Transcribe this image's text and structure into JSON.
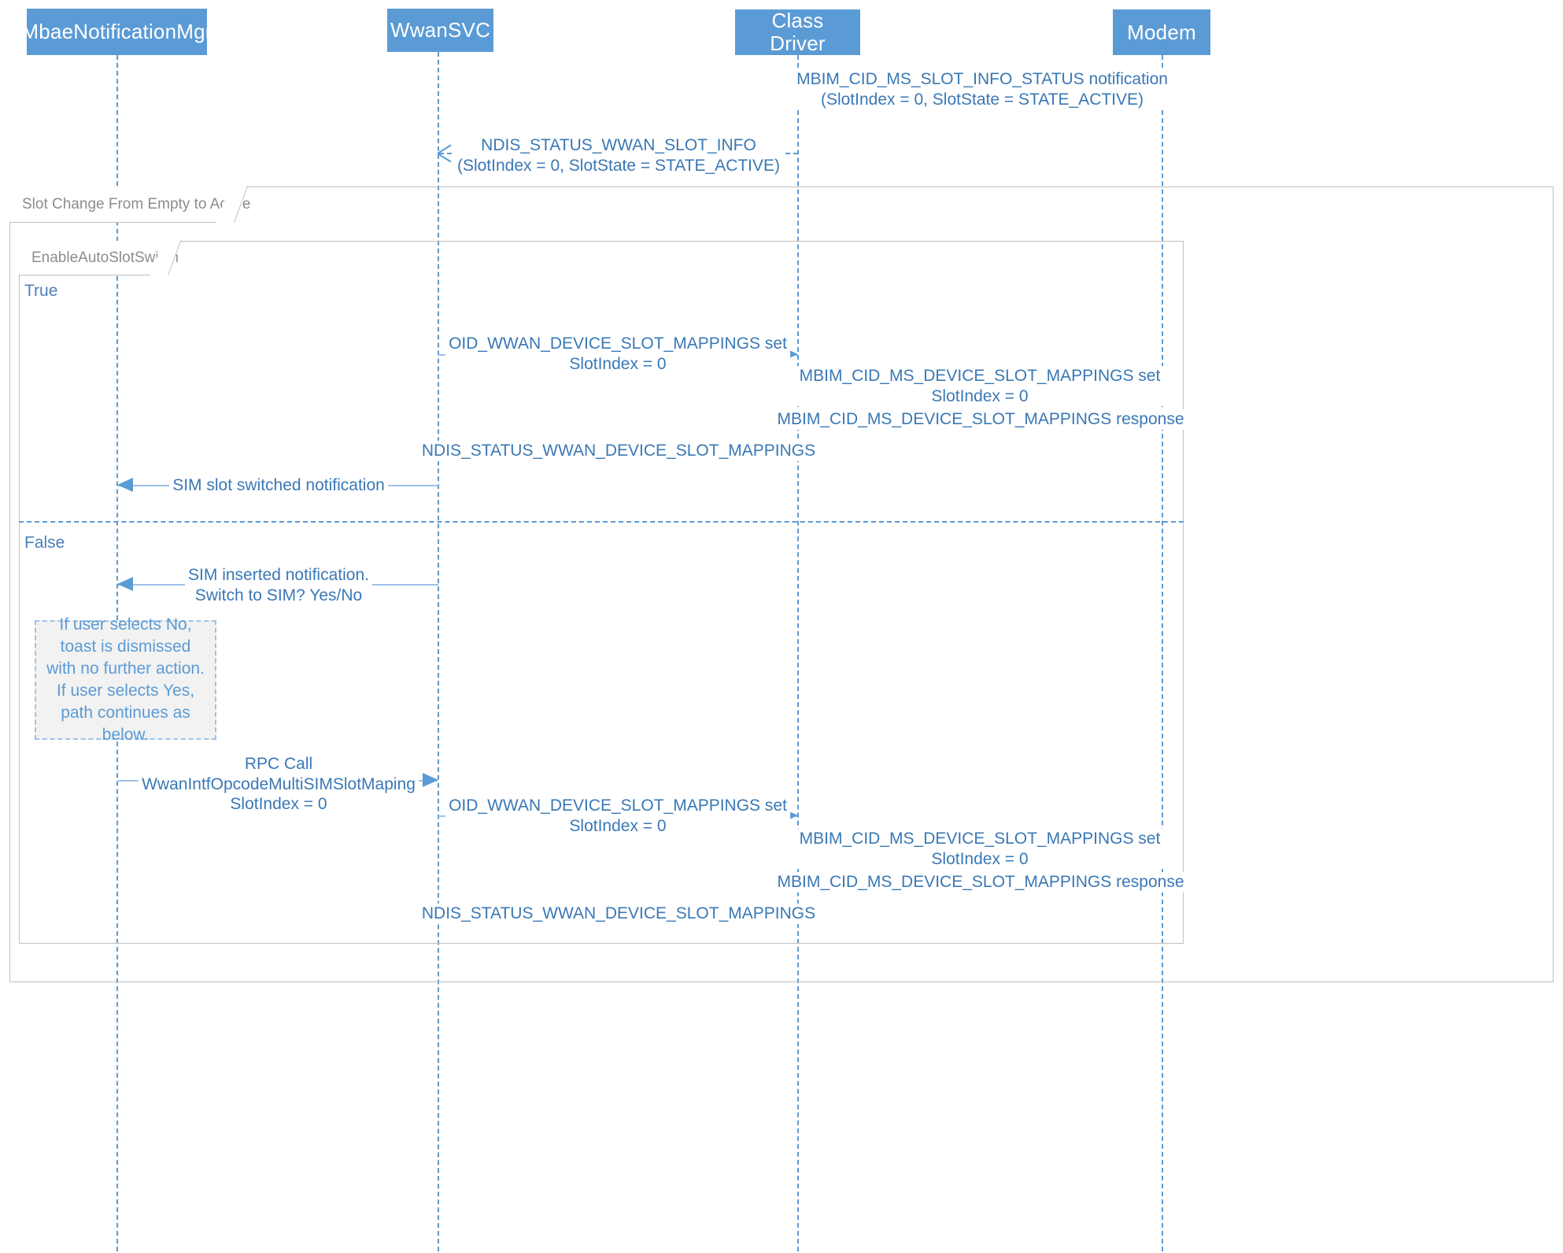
{
  "diagram": {
    "type": "uml-sequence-diagram",
    "participants": [
      {
        "name": "MbaeNotificationMgr"
      },
      {
        "name": "WwanSVC"
      },
      {
        "name": "Class Driver"
      },
      {
        "name": "Modem"
      }
    ],
    "fragments": [
      {
        "label": "Slot Change From Empty to Active"
      },
      {
        "label": "EnableAutoSlotSwitch",
        "guards": [
          "True",
          "False"
        ]
      }
    ],
    "messages": [
      {
        "id": "m1",
        "from": "Modem",
        "to": "Class Driver",
        "style": "dashed",
        "line1": "MBIM_CID_MS_SLOT_INFO_STATUS notification",
        "line2": "(SlotIndex = 0, SlotState = STATE_ACTIVE)"
      },
      {
        "id": "m2",
        "from": "Class Driver",
        "to": "WwanSVC",
        "style": "dashed",
        "line1": "NDIS_STATUS_WWAN_SLOT_INFO",
        "line2": "(SlotIndex = 0, SlotState = STATE_ACTIVE)"
      },
      {
        "id": "m3",
        "from": "WwanSVC",
        "to": "Class Driver",
        "style": "solid",
        "line1": "OID_WWAN_DEVICE_SLOT_MAPPINGS set",
        "line2": "SlotIndex = 0"
      },
      {
        "id": "m4",
        "from": "Class Driver",
        "to": "Modem",
        "style": "solid",
        "line1": "MBIM_CID_MS_DEVICE_SLOT_MAPPINGS set",
        "line2": "SlotIndex = 0"
      },
      {
        "id": "m5",
        "from": "Modem",
        "to": "Class Driver",
        "style": "solid",
        "line1": "MBIM_CID_MS_DEVICE_SLOT_MAPPINGS response",
        "line2": ""
      },
      {
        "id": "m6",
        "from": "Class Driver",
        "to": "WwanSVC",
        "style": "solid",
        "line1": "NDIS_STATUS_WWAN_DEVICE_SLOT_MAPPINGS",
        "line2": ""
      },
      {
        "id": "m7",
        "from": "WwanSVC",
        "to": "MbaeNotificationMgr",
        "style": "solid",
        "line1": "SIM slot switched notification",
        "line2": ""
      },
      {
        "id": "m8",
        "from": "WwanSVC",
        "to": "MbaeNotificationMgr",
        "style": "solid",
        "line1": "SIM inserted notification.",
        "line2": "Switch to SIM? Yes/No"
      },
      {
        "id": "m9",
        "from": "MbaeNotificationMgr",
        "to": "WwanSVC",
        "style": "solid",
        "line1": "RPC Call",
        "line2": "WwanIntfOpcodeMultiSIMSlotMaping",
        "line3": "SlotIndex = 0"
      },
      {
        "id": "m10",
        "from": "WwanSVC",
        "to": "Class Driver",
        "style": "solid",
        "line1": "OID_WWAN_DEVICE_SLOT_MAPPINGS set",
        "line2": "SlotIndex = 0"
      },
      {
        "id": "m11",
        "from": "Class Driver",
        "to": "Modem",
        "style": "solid",
        "line1": "MBIM_CID_MS_DEVICE_SLOT_MAPPINGS set",
        "line2": "SlotIndex = 0"
      },
      {
        "id": "m12",
        "from": "Modem",
        "to": "Class Driver",
        "style": "solid",
        "line1": "MBIM_CID_MS_DEVICE_SLOT_MAPPINGS response",
        "line2": ""
      },
      {
        "id": "m13",
        "from": "Class Driver",
        "to": "WwanSVC",
        "style": "solid",
        "line1": "NDIS_STATUS_WWAN_DEVICE_SLOT_MAPPINGS",
        "line2": ""
      }
    ],
    "note": {
      "text": "If user selects No, toast is dismissed with no further action. If user selects Yes, path continues as below."
    },
    "colors": {
      "participant_fill": "#5b9bd5",
      "participant_text": "#ffffff",
      "message_text": "#3a78b5",
      "lifeline": "#5b9bd5",
      "frame_border": "#bfbfbf",
      "frame_label_text": "#8c8c8c",
      "guard_text": "#4a7ebb",
      "note_fill": "#f2f2f2",
      "note_border": "#9dc3e6"
    }
  }
}
